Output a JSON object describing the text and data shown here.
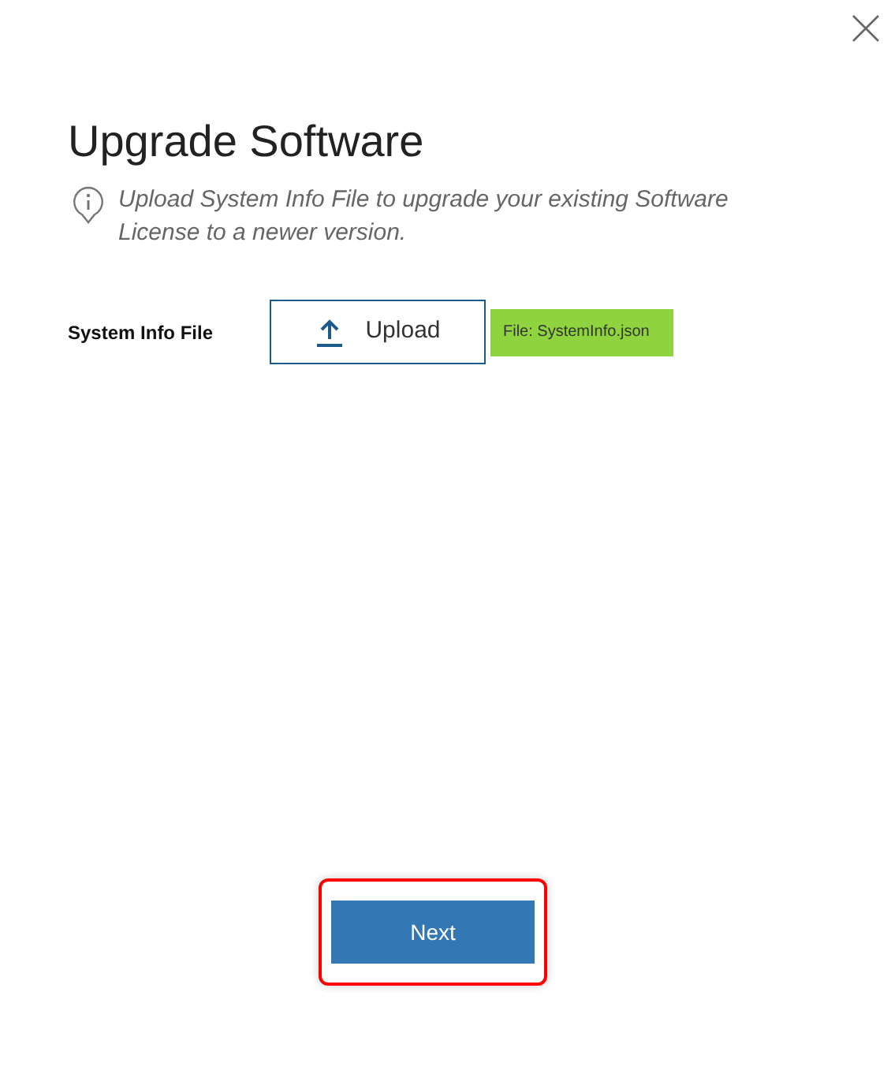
{
  "title": "Upgrade Software",
  "info": "Upload System Info File to upgrade your existing Software License to a newer version.",
  "field": {
    "label": "System Info File",
    "button": "Upload",
    "file": "File: SystemInfo.json"
  },
  "next": {
    "label": "Next",
    "highlighted": true
  }
}
